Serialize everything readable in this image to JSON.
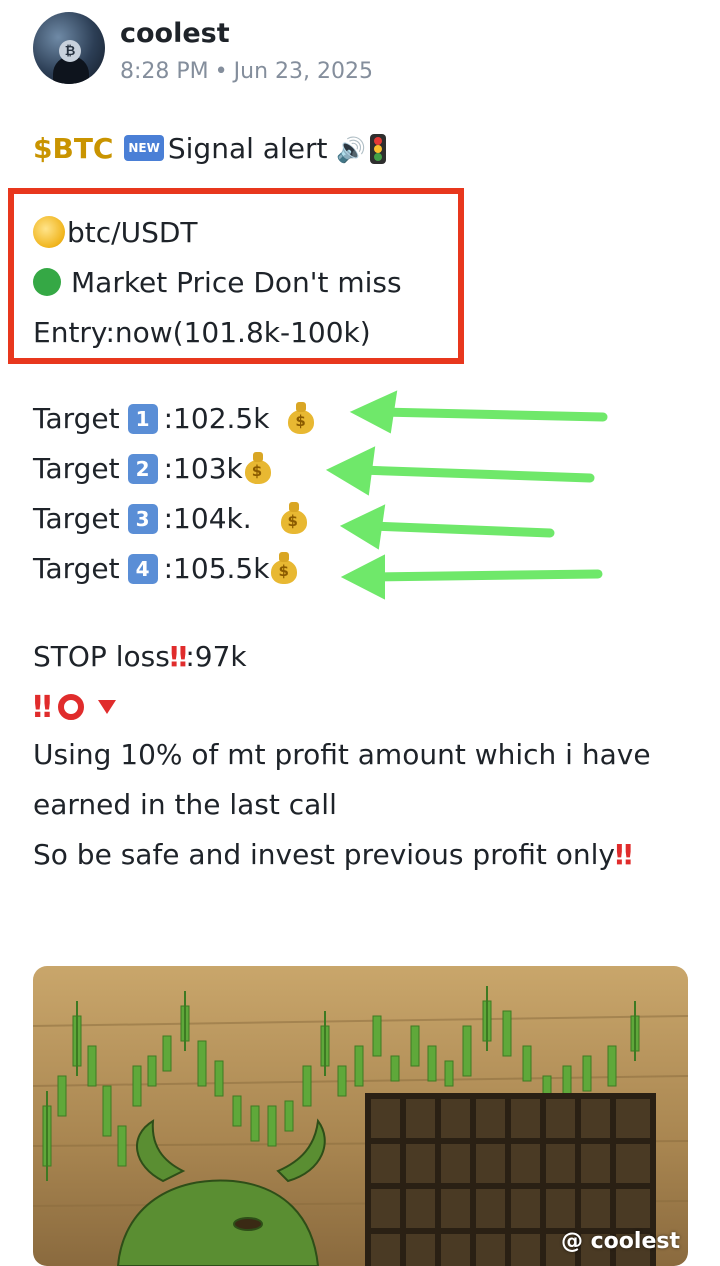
{
  "post": {
    "username": "coolest",
    "time": "8:28 PM",
    "separator": "•",
    "date": "Jun 23, 2025"
  },
  "title": {
    "ticker": "$BTC",
    "badge": "NEW",
    "text": "Signal alert"
  },
  "highlight": {
    "pair": "btc/USDT",
    "market": "Market Price Don't miss",
    "entry": "Entry:now(101.8k-100k)"
  },
  "targets": [
    {
      "label": "Target",
      "num": "1",
      "value": ":102.5k"
    },
    {
      "label": "Target",
      "num": "2",
      "value": ":103k"
    },
    {
      "label": "Target",
      "num": "3",
      "value": ":104k."
    },
    {
      "label": "Target",
      "num": "4",
      "value": ":105.5k"
    }
  ],
  "stop": {
    "label": "STOP loss",
    "value": ":97k"
  },
  "body": {
    "line1": "Using 10% of mt profit amount which i have earned in the last call",
    "line2": "So be safe and invest previous profit only"
  },
  "image": {
    "watermark": "@ coolest"
  },
  "colors": {
    "ticker": "#c99400",
    "highlight_border": "#e8371d",
    "arrows": "#6fe86a",
    "alert_red": "#e02c2c"
  }
}
